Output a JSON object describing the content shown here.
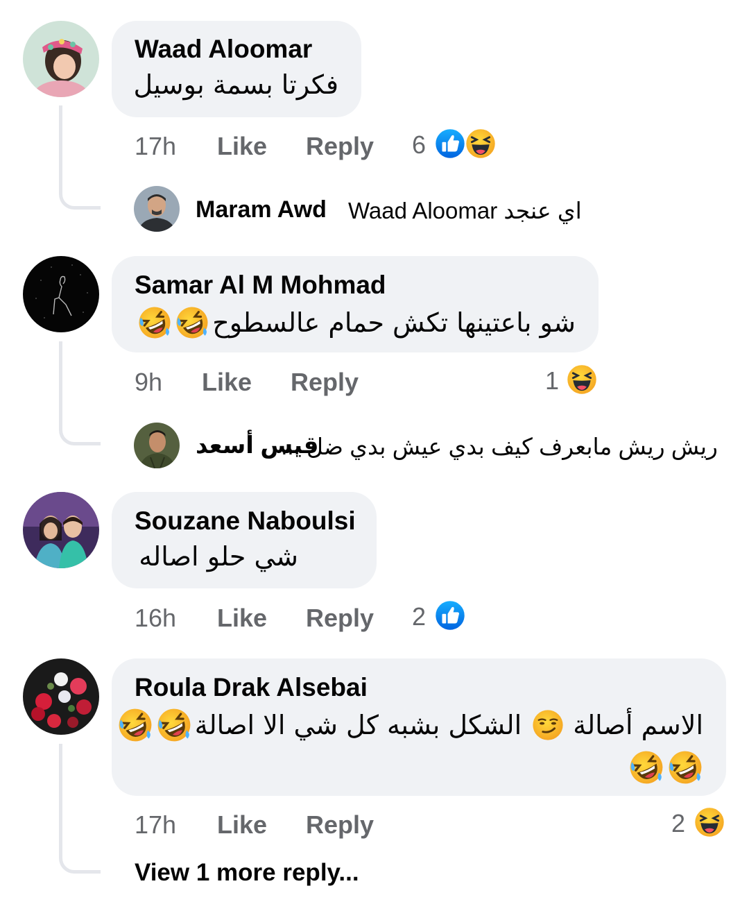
{
  "comments": [
    {
      "author": "Waad Aloomar",
      "text": "فكرتا بسمة بوسيل",
      "time": "17h",
      "like_label": "Like",
      "reply_label": "Reply",
      "reaction_count": "6",
      "reply": {
        "author": "Maram Awd",
        "text": "Waad Aloomar اي عنجد"
      }
    },
    {
      "author": "Samar Al M Mohmad",
      "text": "شو باعتينها تكش حمام عالسطوح",
      "time": "9h",
      "like_label": "Like",
      "reply_label": "Reply",
      "reaction_count": "1",
      "reply": {
        "author": "قيس أسعد",
        "text": "ريش ريش مابعرف كيف بدي عيش بدي ضل ..."
      }
    },
    {
      "author": "Souzane Naboulsi",
      "text": "شي حلو اصاله",
      "time": "16h",
      "like_label": "Like",
      "reply_label": "Reply",
      "reaction_count": "2"
    },
    {
      "author": "Roula Drak Alsebai",
      "text_part1": "الاسم أصالة",
      "text_part2": "الشكل بشبه كل شي الا اصالة",
      "time": "17h",
      "like_label": "Like",
      "reply_label": "Reply",
      "reaction_count": "2",
      "view_more": "View 1 more reply..."
    }
  ],
  "icons": {
    "like": "like-icon",
    "haha": "haha-icon",
    "rofl": "rofl-icon",
    "smirk": "smirk-icon"
  },
  "colors": {
    "bubble": "#f0f2f5",
    "meta": "#65676b",
    "like_blue": "#1877f2",
    "emoji_yellow": "#f7b928"
  }
}
